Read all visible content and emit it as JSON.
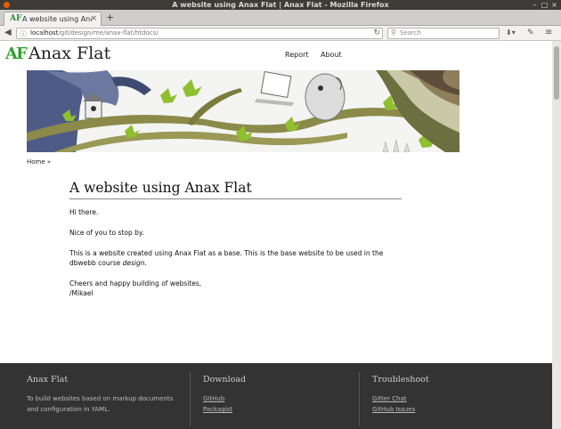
{
  "window": {
    "title": "A website using Anax Flat | Anax Flat - Mozilla Firefox"
  },
  "tabs": [
    {
      "title": "A website using Ana...",
      "icon": "AF"
    }
  ],
  "navbar": {
    "url_host": "localhost",
    "url_path": "/git/design/me/anax-flat/htdocs/",
    "search_placeholder": "Search"
  },
  "site": {
    "logo": "AF",
    "title": "Anax Flat",
    "menu": [
      "Report",
      "About"
    ]
  },
  "breadcrumb": "Home »",
  "article": {
    "heading": "A website using Anax Flat",
    "p1": "Hi there.",
    "p2": "Nice of you to stop by.",
    "p3_before": "This is a website created using Anax Flat as a base. This is the base website to be used in the dbwebb course ",
    "p3_italic": "design",
    "p3_after": ".",
    "p4_line1": "Cheers and happy building of websites,",
    "p4_line2": "/Mikael"
  },
  "footer": {
    "col1": {
      "title": "Anax Flat",
      "text": "To build websites based on markup documents and configuration in YAML."
    },
    "col2": {
      "title": "Download",
      "links": [
        "GitHub",
        "Packagist"
      ]
    },
    "col3": {
      "title": "Troubleshoot",
      "links": [
        "Gitter Chat",
        "GitHub Issues"
      ]
    }
  },
  "colors": {
    "logo_green": "#2fa02f",
    "footer_bg": "#333333",
    "titlebar_bg": "#3c3b37"
  }
}
